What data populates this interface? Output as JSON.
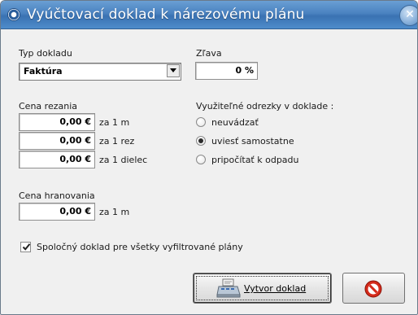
{
  "window": {
    "title": "Vyúčtovací doklad k nárezovému plánu",
    "close_glyph": "✕"
  },
  "doc_type": {
    "label": "Typ dokladu",
    "value": "Faktúra"
  },
  "discount": {
    "label": "Zľava",
    "value": "0 %"
  },
  "cut_price": {
    "label": "Cena rezania",
    "rows": [
      {
        "value": "0,00 €",
        "unit": "za 1 m"
      },
      {
        "value": "0,00 €",
        "unit": "za 1 rez"
      },
      {
        "value": "0,00 €",
        "unit": "za 1 dielec"
      }
    ]
  },
  "edge_price": {
    "label": "Cena hranovania",
    "value": "0,00 €",
    "unit": "za 1 m"
  },
  "offcuts": {
    "label": "Využiteľné odrezky v doklade :",
    "options": [
      {
        "label": "neuvádzať",
        "selected": false
      },
      {
        "label": "uviesť samostatne",
        "selected": true
      },
      {
        "label": "pripočítať k odpadu",
        "selected": false
      }
    ]
  },
  "common_doc": {
    "label": "Spoločný doklad pre všetky vyfiltrované plány",
    "checked": true
  },
  "buttons": {
    "create_label": "Vytvor doklad"
  },
  "icons": {
    "title": "app-icon",
    "close": "close-icon",
    "dropdown": "chevron-down-icon",
    "create": "cash-register-icon",
    "cancel": "no-entry-icon"
  },
  "colors": {
    "titlebar": "#4a82c0",
    "cancel_red": "#d42a1a"
  }
}
